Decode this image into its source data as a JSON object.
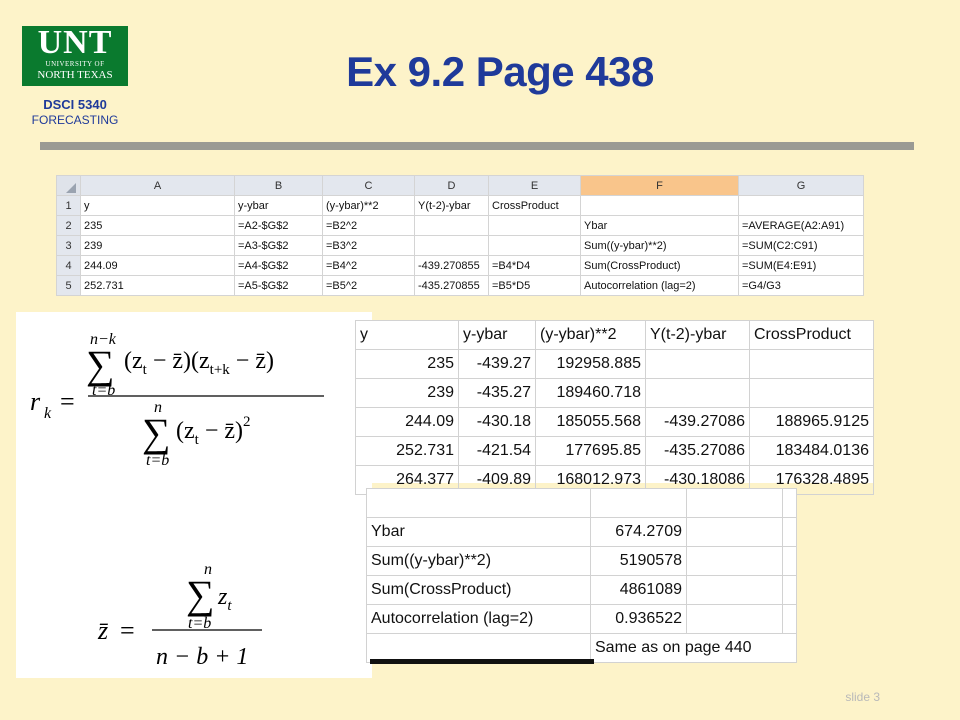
{
  "logo": {
    "main": "UNT",
    "line1": "UNIVERSITY OF",
    "line2": "NORTH TEXAS"
  },
  "course": {
    "code": "DSCI 5340",
    "name": "FORECASTING"
  },
  "title": "Ex 9.2 Page 438",
  "slide_number": "slide 3",
  "formula_sheet": {
    "columns": [
      "A",
      "B",
      "C",
      "D",
      "E",
      "F",
      "G"
    ],
    "selected_column": "F",
    "rows": [
      {
        "num": "1",
        "cells": [
          "y",
          "y-ybar",
          "(y-ybar)**2",
          "Y(t-2)-ybar",
          "CrossProduct",
          "",
          ""
        ]
      },
      {
        "num": "2",
        "cells": [
          "235",
          "=A2-$G$2",
          "=B2^2",
          "",
          "",
          "Ybar",
          "=AVERAGE(A2:A91)"
        ]
      },
      {
        "num": "3",
        "cells": [
          "239",
          "=A3-$G$2",
          "=B3^2",
          "",
          "",
          "Sum((y-ybar)**2)",
          "=SUM(C2:C91)"
        ]
      },
      {
        "num": "4",
        "cells": [
          "244.09",
          "=A4-$G$2",
          "=B4^2",
          "-439.270855",
          "=B4*D4",
          "Sum(CrossProduct)",
          "=SUM(E4:E91)"
        ]
      },
      {
        "num": "5",
        "cells": [
          "252.731",
          "=A5-$G$2",
          "=B5^2",
          "-435.270855",
          "=B5*D5",
          "Autocorrelation (lag=2)",
          "=G4/G3"
        ]
      }
    ]
  },
  "formulas": {
    "rk": {
      "lhs": "r",
      "lhs_sub": "k",
      "eq": "=",
      "num_upper": "n−k",
      "num_lower": "t=b",
      "den_upper": "n",
      "den_lower": "t=b"
    },
    "zbar": {
      "lhs": "z",
      "eq": "=",
      "num_upper": "n",
      "num_lower": "t=b",
      "num_term": "z",
      "num_term_sub": "t",
      "den": "n − b + 1"
    }
  },
  "values_table": {
    "headers": [
      "y",
      "y-ybar",
      "(y-ybar)**2",
      "Y(t-2)-ybar",
      "CrossProduct"
    ],
    "rows": [
      [
        "235",
        "-439.27",
        "192958.885",
        "",
        ""
      ],
      [
        "239",
        "-435.27",
        "189460.718",
        "",
        ""
      ],
      [
        "244.09",
        "-430.18",
        "185055.568",
        "-439.27086",
        "188965.9125"
      ],
      [
        "252.731",
        "-421.54",
        "177695.85",
        "-435.27086",
        "183484.0136"
      ],
      [
        "264.377",
        "-409.89",
        "168012.973",
        "-430.18086",
        "176328.4895"
      ]
    ]
  },
  "stats_table": {
    "rows": [
      [
        "Ybar",
        "674.2709"
      ],
      [
        "Sum((y-ybar)**2)",
        "5190578"
      ],
      [
        "Sum(CrossProduct)",
        "4861089"
      ],
      [
        "Autocorrelation (lag=2)",
        "0.936522"
      ]
    ],
    "note": "Same as on page 440"
  },
  "colors": {
    "background": "#fdf3c9",
    "title": "#1f3a9a",
    "logo": "#0a7a2e",
    "selected_header": "#f9c58b"
  }
}
